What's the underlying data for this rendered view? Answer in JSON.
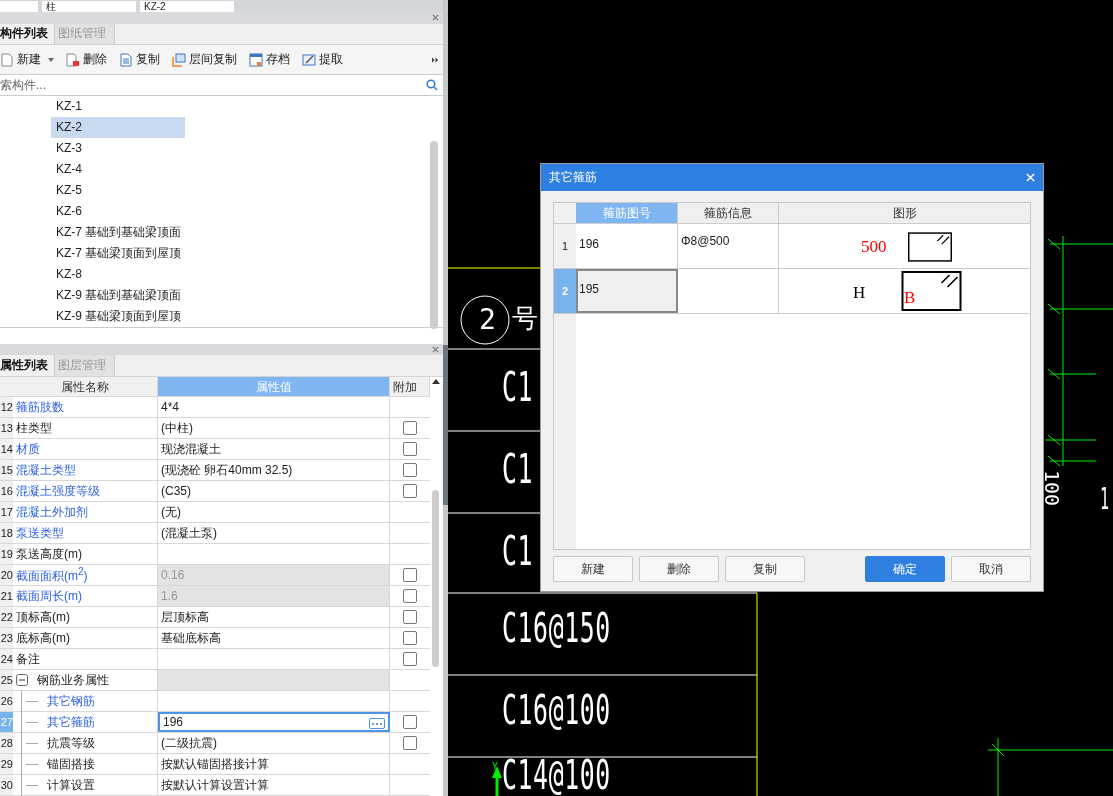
{
  "top_bar": {
    "fields": [
      "柱",
      "KZ-2"
    ]
  },
  "component_panel": {
    "tabs": [
      {
        "label": "构件列表",
        "selected": true
      },
      {
        "label": "图纸管理",
        "selected": false
      }
    ],
    "toolbar": [
      {
        "label": "新建",
        "kind": "new",
        "dropdown": true
      },
      {
        "label": "删除",
        "kind": "delete",
        "dropdown": false
      },
      {
        "label": "复制",
        "kind": "copy",
        "dropdown": false
      },
      {
        "label": "层间复制",
        "kind": "floor-copy",
        "dropdown": false
      },
      {
        "label": "存档",
        "kind": "save",
        "dropdown": false
      },
      {
        "label": "提取",
        "kind": "extract",
        "dropdown": false
      }
    ],
    "search": {
      "placeholder": "索构件..."
    },
    "items": [
      {
        "label": "KZ-1",
        "selected": false
      },
      {
        "label": "KZ-2",
        "selected": true
      },
      {
        "label": "KZ-3",
        "selected": false
      },
      {
        "label": "KZ-4",
        "selected": false
      },
      {
        "label": "KZ-5",
        "selected": false
      },
      {
        "label": "KZ-6",
        "selected": false
      },
      {
        "label": "KZ-7 基础到基础梁顶面",
        "selected": false
      },
      {
        "label": "KZ-7 基础梁顶面到屋顶",
        "selected": false
      },
      {
        "label": "KZ-8",
        "selected": false
      },
      {
        "label": "KZ-9 基础到基础梁顶面",
        "selected": false
      },
      {
        "label": "KZ-9 基础梁顶面到屋顶",
        "selected": false
      }
    ]
  },
  "property_panel": {
    "tabs": [
      {
        "label": "属性列表",
        "selected": true
      },
      {
        "label": "图层管理",
        "selected": false
      }
    ],
    "columns": [
      {
        "label": "属性名称",
        "selected": false
      },
      {
        "label": "属性值",
        "selected": true
      },
      {
        "label": "附加",
        "selected": false
      }
    ],
    "rows": [
      {
        "number": "12",
        "name": "箍筋肢数",
        "value": "4*4",
        "linked": true,
        "disabled": false,
        "selected": false
      },
      {
        "number": "13",
        "name": "柱类型",
        "value": "(中柱)",
        "linked": false,
        "disabled": false,
        "selected": false,
        "checkbox": {
          "checked": false
        }
      },
      {
        "number": "14",
        "name": "材质",
        "value": "现浇混凝土",
        "linked": true,
        "disabled": false,
        "selected": false,
        "checkbox": {
          "checked": false
        }
      },
      {
        "number": "15",
        "name": "混凝土类型",
        "value": "(现浇砼 卵石40mm 32.5)",
        "linked": true,
        "disabled": false,
        "selected": false,
        "checkbox": {
          "checked": false
        }
      },
      {
        "number": "16",
        "name": "混凝土强度等级",
        "value": "(C35)",
        "linked": true,
        "disabled": false,
        "selected": false,
        "checkbox": {
          "checked": false
        }
      },
      {
        "number": "17",
        "name": "混凝土外加剂",
        "value": "(无)",
        "linked": true,
        "disabled": false,
        "selected": false
      },
      {
        "number": "18",
        "name": "泵送类型",
        "value": "(混凝土泵)",
        "linked": true,
        "disabled": false,
        "selected": false
      },
      {
        "number": "19",
        "name": "泵送高度(m)",
        "linked": false,
        "disabled": false,
        "selected": false
      },
      {
        "number": "20",
        "name": "截面面积(m$^{2}$)",
        "value": "0.16",
        "linked": true,
        "disabled": true,
        "selected": false,
        "checkbox": {
          "checked": false
        }
      },
      {
        "number": "21",
        "name": "截面周长(m)",
        "value": "1.6",
        "linked": true,
        "disabled": true,
        "selected": false,
        "checkbox": {
          "checked": false
        }
      },
      {
        "number": "22",
        "name": "顶标高(m)",
        "value": "层顶标高",
        "linked": false,
        "disabled": false,
        "selected": false,
        "checkbox": {
          "checked": false
        }
      },
      {
        "number": "23",
        "name": "底标高(m)",
        "value": "基础底标高",
        "linked": false,
        "disabled": false,
        "selected": false,
        "checkbox": {
          "checked": false
        }
      },
      {
        "number": "24",
        "name": "备注",
        "linked": false,
        "disabled": false,
        "selected": false,
        "checkbox": {
          "checked": false
        }
      },
      {
        "number": "25",
        "name": "钢筋业务属性",
        "linked": false,
        "disabled": true,
        "selected": false,
        "expanded": true,
        "children": [
          {
            "number": "26",
            "name": "其它钢筋",
            "linked": true,
            "disabled": false,
            "selected": false
          },
          {
            "number": "27",
            "name": "其它箍筋",
            "value": "196",
            "linked": true,
            "disabled": false,
            "selected": true,
            "checkbox": {
              "checked": false
            }
          },
          {
            "number": "28",
            "name": "抗震等级",
            "value": "(二级抗震)",
            "linked": false,
            "disabled": false,
            "selected": false,
            "checkbox": {
              "checked": false
            }
          },
          {
            "number": "29",
            "name": "锚固搭接",
            "value": "按默认锚固搭接计算",
            "linked": false,
            "disabled": false,
            "selected": false
          },
          {
            "number": "30",
            "name": "计算设置",
            "value": "按默认计算设置计算",
            "linked": false,
            "disabled": false,
            "selected": false
          }
        ]
      }
    ]
  },
  "cad": {
    "marker": "2",
    "marker_note": "号",
    "labels": [
      "C1",
      "C1",
      "C1",
      "C16@150",
      "C16@100",
      "C14@100"
    ],
    "axis_label": "Y",
    "side_labels": [
      "100",
      "1"
    ]
  },
  "dialog": {
    "title": "其它箍筋",
    "columns": [
      {
        "label": "箍筋图号",
        "selected": true
      },
      {
        "label": "箍筋信息",
        "selected": false
      },
      {
        "label": "图形",
        "selected": false
      }
    ],
    "rows": [
      {
        "number": "1",
        "code": "196",
        "info": "Φ8@500",
        "selected": false,
        "shape_labels": [
          {
            "text": "500",
            "color": "#ff0000"
          }
        ]
      },
      {
        "number": "2",
        "code": "195",
        "selected": true,
        "shape_labels": [
          {
            "text": "H",
            "color": "#000000"
          },
          {
            "text": "B",
            "color": "#ff0000"
          }
        ]
      }
    ],
    "buttons": [
      {
        "label": "新建",
        "primary": false
      },
      {
        "label": "删除",
        "primary": false
      },
      {
        "label": "复制",
        "primary": false
      },
      {
        "label": "确定",
        "primary": true
      },
      {
        "label": "取消",
        "primary": false
      }
    ]
  }
}
